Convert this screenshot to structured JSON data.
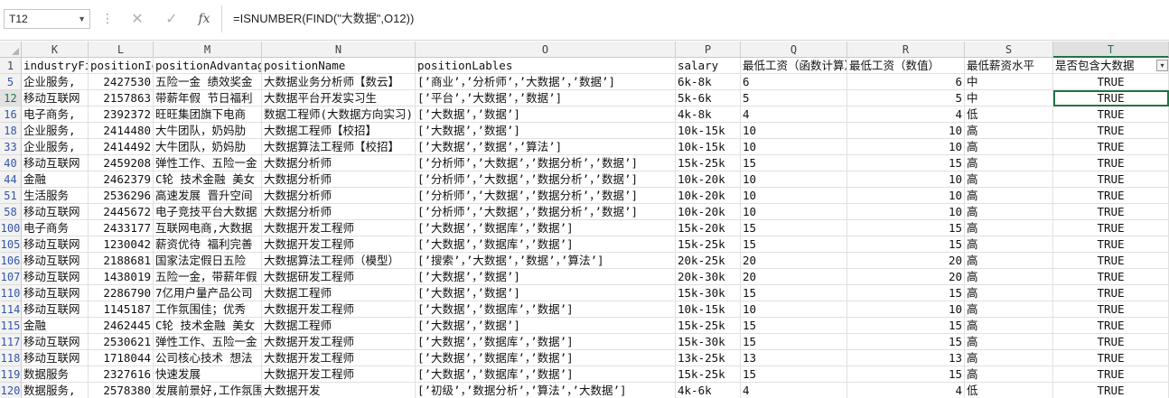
{
  "formula_bar": {
    "name_box": "T12",
    "formula": "=ISNUMBER(FIND(\"大数据\",O12))",
    "fx_label": "fx",
    "cancel_glyph": "✕",
    "enter_glyph": "✓"
  },
  "columns": [
    "K",
    "L",
    "M",
    "N",
    "O",
    "P",
    "Q",
    "R",
    "S",
    "T"
  ],
  "selected_column": "T",
  "header_row": {
    "row_num": "1",
    "cells": [
      "industryField",
      "positionId",
      "positionAdvantage",
      "positionName",
      "positionLables",
      "salary",
      "最低工资（函数计算）",
      "最低工资（数值）",
      "最低薪资水平",
      "是否包含大数据"
    ]
  },
  "rows": [
    {
      "num": "5",
      "cells": [
        "企业服务,",
        "2427530",
        "五险一金 绩效奖金",
        "大数据业务分析师【数云】",
        "[’商业’，’分析师’，’大数据’，’数据’]",
        "6k-8k",
        "6",
        "6",
        "中",
        "TRUE"
      ]
    },
    {
      "num": "12",
      "cells": [
        "移动互联网",
        "2157863",
        "带薪年假 节日福利",
        "大数据平台开发实习生",
        "[’平台’，’大数据’，’数据’]",
        "5k-6k",
        "5",
        "5",
        "中",
        "TRUE"
      ]
    },
    {
      "num": "16",
      "cells": [
        "电子商务,",
        "2392372",
        "旺旺集团旗下电商",
        "数据工程师(大数据方向实习)",
        "[’大数据’，’数据’]",
        "4k-8k",
        "4",
        "4",
        "低",
        "TRUE"
      ]
    },
    {
      "num": "18",
      "cells": [
        "企业服务,",
        "2414480",
        "大牛团队，奶妈肋",
        "大数据工程师【校招】",
        "[’大数据’，’数据’]",
        "10k-15k",
        "10",
        "10",
        "高",
        "TRUE"
      ]
    },
    {
      "num": "33",
      "cells": [
        "企业服务,",
        "2414492",
        "大牛团队，奶妈肋",
        "大数据算法工程师【校招】",
        "[’大数据’，’数据’，’算法’]",
        "10k-15k",
        "10",
        "10",
        "高",
        "TRUE"
      ]
    },
    {
      "num": "40",
      "cells": [
        "移动互联网",
        "2459208",
        "弹性工作、五险一金",
        "大数据分析师",
        "[’分析师’，’大数据’，’数据分析’，’数据’]",
        "15k-25k",
        "15",
        "15",
        "高",
        "TRUE"
      ]
    },
    {
      "num": "44",
      "cells": [
        "金融",
        "2462379",
        "C轮 技术金融 美女",
        "大数据分析师",
        "[’分析师’，’大数据’，’数据分析’，’数据’]",
        "10k-20k",
        "10",
        "10",
        "高",
        "TRUE"
      ]
    },
    {
      "num": "51",
      "cells": [
        "生活服务",
        "2536296",
        "高速发展 晋升空间",
        "大数据分析师",
        "[’分析师’，’大数据’，’数据分析’，’数据’]",
        "10k-20k",
        "10",
        "10",
        "高",
        "TRUE"
      ]
    },
    {
      "num": "58",
      "cells": [
        "移动互联网",
        "2445672",
        "电子竞技平台大数据",
        "大数据分析师",
        "[’分析师’，’大数据’，’数据分析’，’数据’]",
        "10k-20k",
        "10",
        "10",
        "高",
        "TRUE"
      ]
    },
    {
      "num": "100",
      "cells": [
        "电子商务",
        "2433177",
        "互联网电商,大数据",
        "大数据开发工程师",
        "[’大数据’，’数据库’，’数据’]",
        "15k-20k",
        "15",
        "15",
        "高",
        "TRUE"
      ]
    },
    {
      "num": "105",
      "cells": [
        "移动互联网",
        "1230042",
        "薪资优待 福利完善",
        "大数据开发工程师",
        "[’大数据’，’数据库’，’数据’]",
        "15k-25k",
        "15",
        "15",
        "高",
        "TRUE"
      ]
    },
    {
      "num": "106",
      "cells": [
        "移动互联网",
        "2188681",
        "国家法定假日五险",
        "大数据算法工程师（模型）",
        "[’搜索’，’大数据’，’数据’，’算法’]",
        "20k-25k",
        "20",
        "20",
        "高",
        "TRUE"
      ]
    },
    {
      "num": "107",
      "cells": [
        "移动互联网",
        "1438019",
        "五险一金，带薪年假",
        "大数据研发工程师",
        "[’大数据’，’数据’]",
        "20k-30k",
        "20",
        "20",
        "高",
        "TRUE"
      ]
    },
    {
      "num": "110",
      "cells": [
        "移动互联网",
        "2286790",
        "7亿用户量产品公司",
        "大数据工程师",
        "[’大数据’，’数据’]",
        "15k-30k",
        "15",
        "15",
        "高",
        "TRUE"
      ]
    },
    {
      "num": "114",
      "cells": [
        "移动互联网",
        "1145187",
        "工作氛围佳；优秀",
        "大数据开发工程师",
        "[’大数据’，’数据库’，’数据’]",
        "10k-15k",
        "10",
        "10",
        "高",
        "TRUE"
      ]
    },
    {
      "num": "115",
      "cells": [
        "金融",
        "2462445",
        "C轮 技术金融 美女",
        "大数据工程师",
        "[’大数据’，’数据’]",
        "15k-25k",
        "15",
        "15",
        "高",
        "TRUE"
      ]
    },
    {
      "num": "117",
      "cells": [
        "移动互联网",
        "2530621",
        "弹性工作、五险一金",
        "大数据开发工程师",
        "[’大数据’，’数据库’，’数据’]",
        "15k-30k",
        "15",
        "15",
        "高",
        "TRUE"
      ]
    },
    {
      "num": "118",
      "cells": [
        "移动互联网",
        "1718044",
        "公司核心技术 想法",
        "大数据开发工程师",
        "[’大数据’，’数据库’，’数据’]",
        "13k-25k",
        "13",
        "13",
        "高",
        "TRUE"
      ]
    },
    {
      "num": "119",
      "cells": [
        "数据服务",
        "2327616",
        "快速发展",
        "大数据开发工程师",
        "[’大数据’，’数据库’，’数据’]",
        "15k-25k",
        "15",
        "15",
        "高",
        "TRUE"
      ]
    },
    {
      "num": "120",
      "cells": [
        "数据服务,",
        "2578380",
        "发展前景好,工作氛围",
        "大数据开发",
        "[’初级’，’数据分析’，’算法’，’大数据’]",
        "4k-6k",
        "4",
        "4",
        "低",
        "TRUE"
      ]
    }
  ],
  "active_row": "12",
  "colors": {
    "accent": "#217346",
    "row_header_text": "#3355aa"
  }
}
